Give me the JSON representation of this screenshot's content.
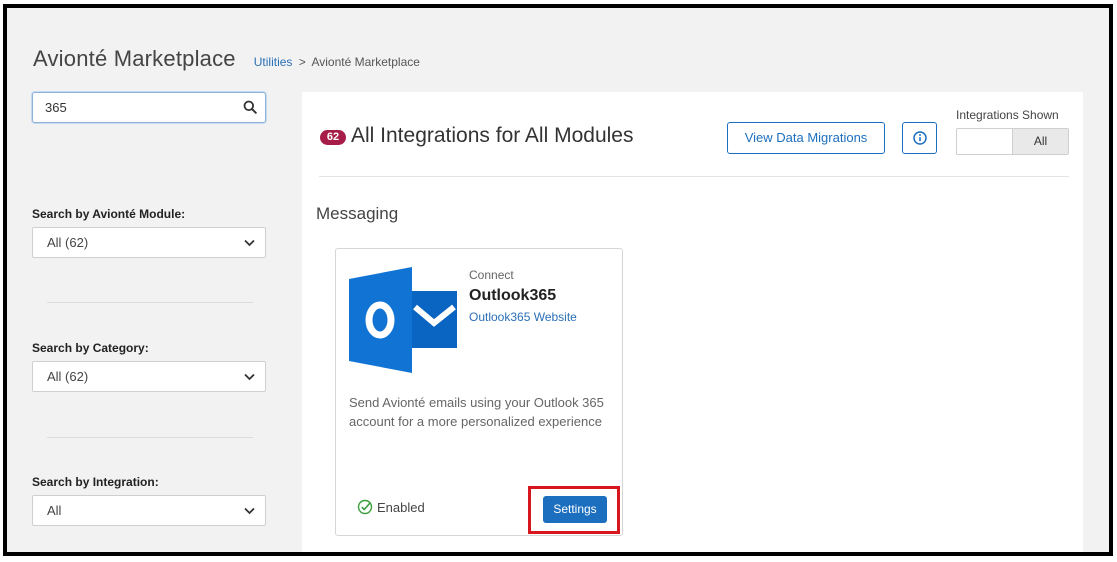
{
  "page": {
    "title": "Avionté Marketplace",
    "breadcrumb": {
      "link": "Utilities",
      "separator": ">",
      "current": "Avionté Marketplace"
    }
  },
  "sidebar": {
    "search": {
      "value": "365",
      "icon": "search-icon"
    },
    "filters": [
      {
        "label": "Search by Avionté Module:",
        "selected": "All (62)"
      },
      {
        "label": "Search by Category:",
        "selected": "All (62)"
      },
      {
        "label": "Search by Integration:",
        "selected": "All"
      }
    ]
  },
  "main": {
    "count_badge": "62",
    "title": "All Integrations for All Modules",
    "view_migrations_label": "View Data Migrations",
    "info_icon": "info-icon",
    "integrations_shown": {
      "label": "Integrations Shown",
      "selected": "All"
    },
    "section": "Messaging",
    "card": {
      "connect_label": "Connect",
      "name": "Outlook365",
      "website_label": "Outlook365 Website",
      "description": "Send Avionté emails using your Outlook 365 account for a more personalized experience",
      "status": "Enabled",
      "settings_label": "Settings"
    }
  },
  "colors": {
    "accent": "#1c6fbf",
    "badge": "#a61d4a",
    "enabled": "#3a9d3a",
    "highlight": "#d8161f"
  }
}
